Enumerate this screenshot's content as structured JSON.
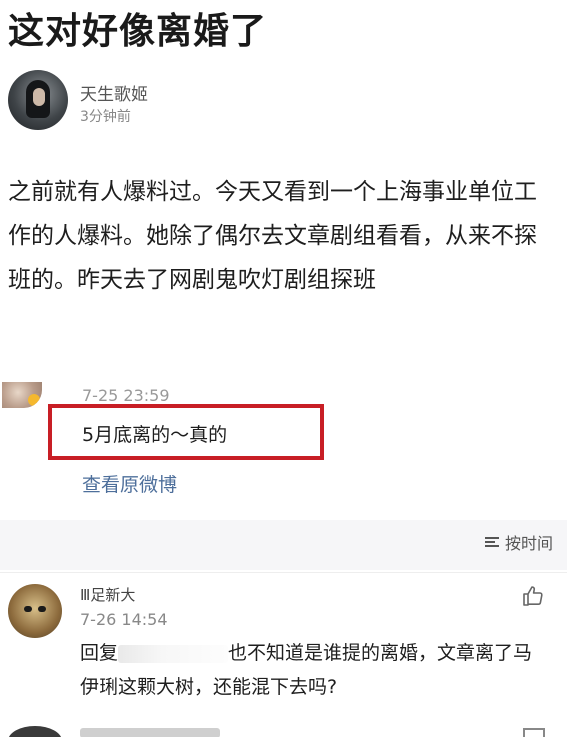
{
  "headline": "这对好像离婚了",
  "post": {
    "username": "天生歌姬",
    "time": "3分钟前",
    "body": "之前就有人爆料过。今天又看到一个上海事业单位工作的人爆料。她除了偶尔去文章剧组看看，从来不探班的。昨天去了网剧鬼吹灯剧组探班"
  },
  "repost": {
    "timestamp": "7-25 23:59",
    "text": "5月底离的～真的",
    "view_original": "查看原微博"
  },
  "comments_header": {
    "sort_label": "按时间"
  },
  "comment": {
    "name_fragment": "Ⅲ足新大",
    "time": "7-26 14:54",
    "reply_prefix": "回复",
    "body_text": "也不知道是谁提的离婚，文章离了马伊琍这颗大树，还能混下去吗?"
  },
  "colors": {
    "highlight_box": "#c81e25",
    "link": "#4e6f9b"
  },
  "icons": {
    "like": "thumbs-up-icon",
    "sort": "sort-icon"
  }
}
